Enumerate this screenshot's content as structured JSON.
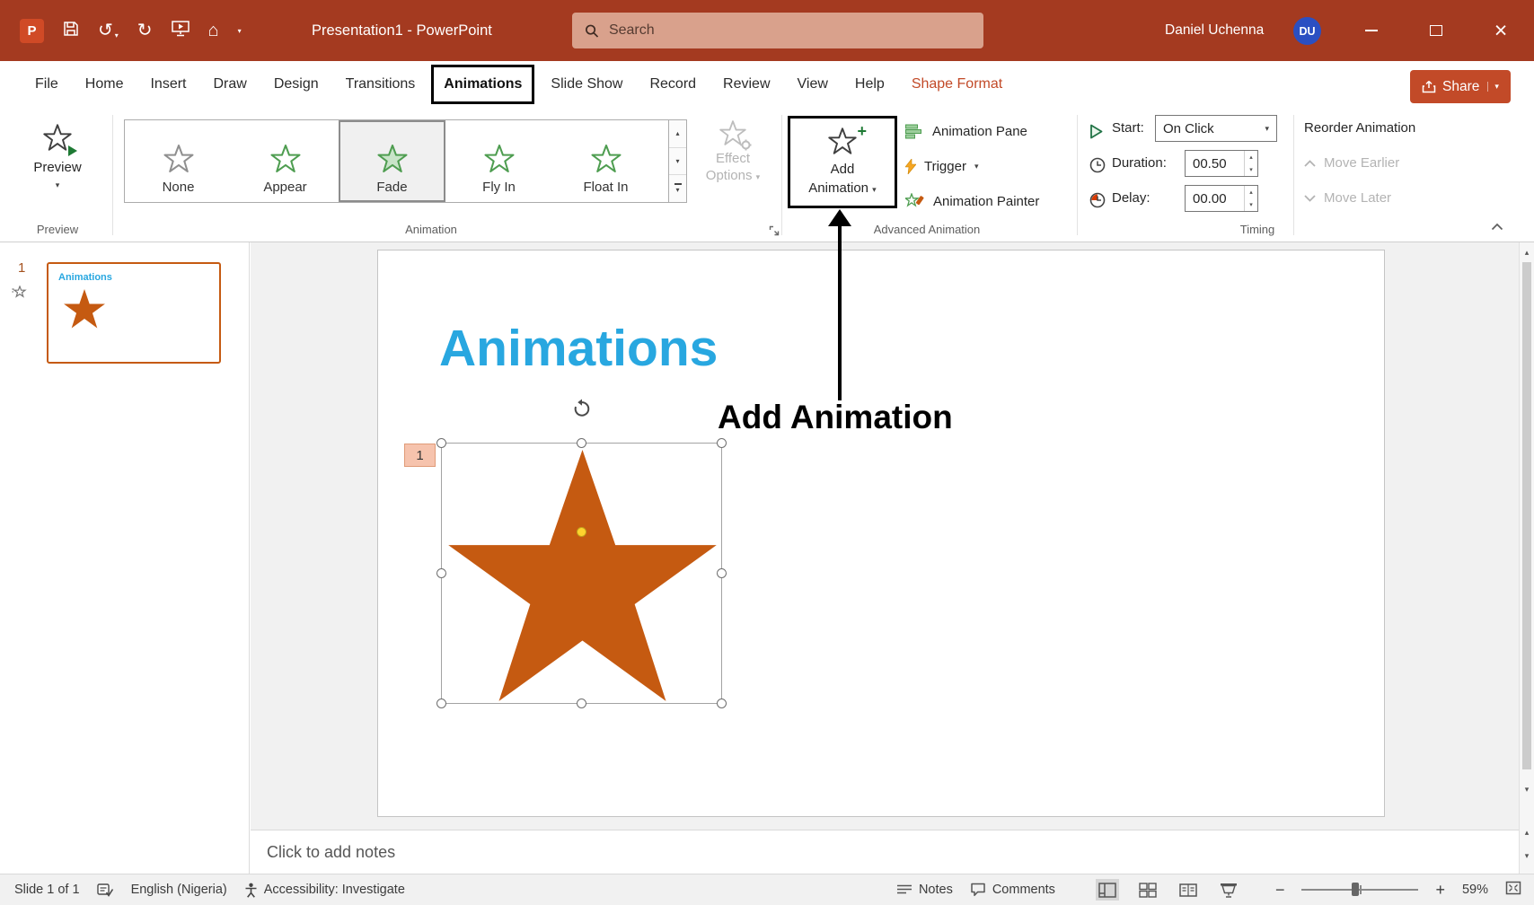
{
  "titlebar": {
    "app_title": "Presentation1  -  PowerPoint",
    "search_placeholder": "Search",
    "user_name": "Daniel Uchenna",
    "user_initials": "DU"
  },
  "tabs": {
    "items": [
      {
        "label": "File"
      },
      {
        "label": "Home"
      },
      {
        "label": "Insert"
      },
      {
        "label": "Draw"
      },
      {
        "label": "Design"
      },
      {
        "label": "Transitions"
      },
      {
        "label": "Animations",
        "selected": true
      },
      {
        "label": "Slide Show"
      },
      {
        "label": "Record"
      },
      {
        "label": "Review"
      },
      {
        "label": "View"
      },
      {
        "label": "Help"
      },
      {
        "label": "Shape Format",
        "contextual": true
      }
    ],
    "share_label": "Share"
  },
  "ribbon": {
    "preview": {
      "button_label": "Preview",
      "group_label": "Preview"
    },
    "animation": {
      "gallery": [
        {
          "label": "None"
        },
        {
          "label": "Appear"
        },
        {
          "label": "Fade",
          "selected": true
        },
        {
          "label": "Fly In"
        },
        {
          "label": "Float In"
        }
      ],
      "effect_options_line1": "Effect",
      "effect_options_line2": "Options",
      "group_label": "Animation"
    },
    "advanced": {
      "add_animation_line1": "Add",
      "add_animation_line2": "Animation",
      "animation_pane": "Animation Pane",
      "trigger": "Trigger",
      "animation_painter": "Animation Painter",
      "group_label": "Advanced Animation"
    },
    "timing": {
      "start_label": "Start:",
      "start_value": "On Click",
      "duration_label": "Duration:",
      "duration_value": "00.50",
      "delay_label": "Delay:",
      "delay_value": "00.00",
      "reorder_label": "Reorder Animation",
      "move_earlier": "Move Earlier",
      "move_later": "Move Later",
      "group_label": "Timing"
    }
  },
  "thumbnails": {
    "slide_number": "1",
    "slide_title": "Animations"
  },
  "slide": {
    "title": "Animations",
    "animation_badge": "1"
  },
  "callout": {
    "label": "Add Animation"
  },
  "notes": {
    "placeholder": "Click to add notes"
  },
  "statusbar": {
    "slide_indicator": "Slide 1 of 1",
    "language": "English (Nigeria)",
    "accessibility": "Accessibility: Investigate",
    "notes_label": "Notes",
    "comments_label": "Comments",
    "zoom_level": "59%"
  },
  "colors": {
    "titlebar_bg": "#A43A20",
    "search_bg": "#D9A18C",
    "accent_red": "#C24A28",
    "star_orange": "#C55A11",
    "slide_title_blue": "#28A7E0",
    "gallery_green": "#4E9D50",
    "avatar_blue": "#2B4FC2",
    "badge_bg": "#F6C3AD"
  }
}
